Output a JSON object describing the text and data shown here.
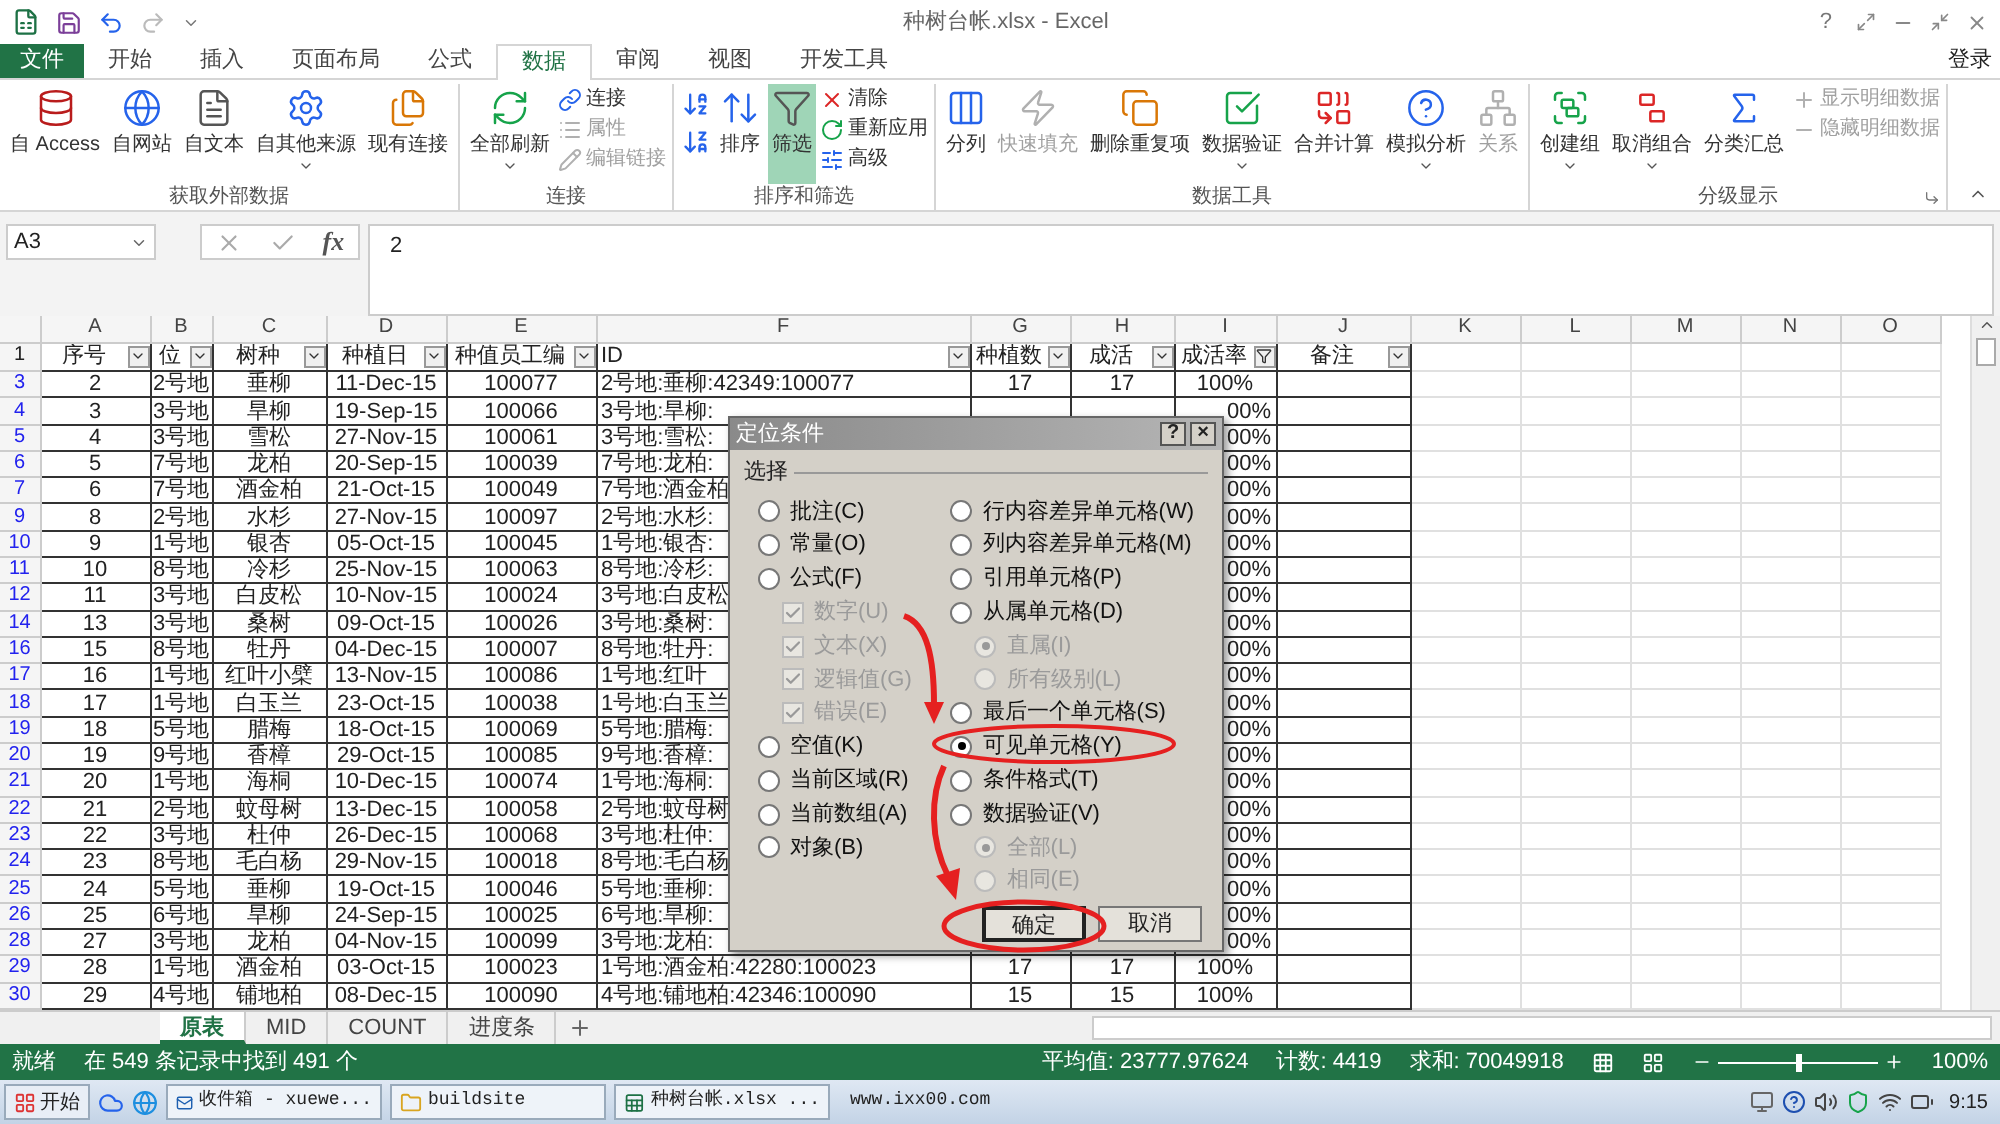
{
  "window": {
    "title": "种树台帐.xlsx - Excel",
    "help": "?"
  },
  "tabs": [
    {
      "label": "文件",
      "selected": false,
      "kind": "file"
    },
    {
      "label": "开始",
      "selected": false,
      "kind": "tab"
    },
    {
      "label": "插入",
      "selected": false,
      "kind": "tab"
    },
    {
      "label": "页面布局",
      "selected": false,
      "kind": "tab"
    },
    {
      "label": "公式",
      "selected": false,
      "kind": "tab"
    },
    {
      "label": "数据",
      "selected": true,
      "kind": "tab"
    },
    {
      "label": "审阅",
      "selected": false,
      "kind": "tab"
    },
    {
      "label": "视图",
      "selected": false,
      "kind": "tab"
    },
    {
      "label": "开发工具",
      "selected": false,
      "kind": "tab"
    }
  ],
  "account": "登录",
  "ribbon": [
    {
      "label": "获取外部数据",
      "items": [
        {
          "kind": "large",
          "label": "自 Access",
          "disabled": false
        },
        {
          "kind": "large",
          "label": "自网站",
          "disabled": false
        },
        {
          "kind": "large",
          "label": "自文本",
          "disabled": false
        },
        {
          "kind": "large",
          "label": "自其他来源",
          "disabled": false,
          "dropdown": true
        },
        {
          "kind": "large",
          "label": "现有连接",
          "disabled": false
        }
      ]
    },
    {
      "label": "连接",
      "items": [
        {
          "kind": "large",
          "label": "全部刷新",
          "disabled": false,
          "dropdown": true
        },
        {
          "kind": "small",
          "label": "连接",
          "disabled": false
        },
        {
          "kind": "small",
          "label": "属性",
          "disabled": true
        },
        {
          "kind": "small",
          "label": "编辑链接",
          "disabled": true
        }
      ]
    },
    {
      "label": "排序和筛选",
      "items": [
        {
          "kind": "sort",
          "disabled": false
        },
        {
          "kind": "sort",
          "disabled": false
        },
        {
          "kind": "large",
          "label": "排序",
          "disabled": false
        },
        {
          "kind": "large",
          "label": "筛选",
          "disabled": false,
          "on": true
        },
        {
          "kind": "small",
          "label": "清除",
          "disabled": false
        },
        {
          "kind": "small",
          "label": "重新应用",
          "disabled": false
        },
        {
          "kind": "small",
          "label": "高级",
          "disabled": false
        }
      ]
    },
    {
      "label": "数据工具",
      "items": [
        {
          "kind": "large",
          "label": "分列",
          "disabled": false
        },
        {
          "kind": "large",
          "label": "快速填充",
          "disabled": true
        },
        {
          "kind": "large",
          "label": "删除重复项",
          "disabled": false
        },
        {
          "kind": "large",
          "label": "数据验证",
          "disabled": false,
          "dropdown": true
        },
        {
          "kind": "large",
          "label": "合并计算",
          "disabled": false
        },
        {
          "kind": "large",
          "label": "模拟分析",
          "disabled": false,
          "dropdown": true
        },
        {
          "kind": "large",
          "label": "关系",
          "disabled": true
        }
      ]
    },
    {
      "label": "分级显示",
      "launcher": true,
      "items": [
        {
          "kind": "large",
          "label": "创建组",
          "disabled": false,
          "dropdown": true
        },
        {
          "kind": "large",
          "label": "取消组合",
          "disabled": false,
          "dropdown": true
        },
        {
          "kind": "large",
          "label": "分类汇总",
          "disabled": false
        },
        {
          "kind": "small",
          "label": "显示明细数据",
          "disabled": true
        },
        {
          "kind": "small",
          "label": "隐藏明细数据",
          "disabled": true
        }
      ]
    }
  ],
  "formula_bar": {
    "name_box": "A3",
    "function_label": "fx",
    "value": "2"
  },
  "sheet": {
    "columns": [
      "A",
      "B",
      "C",
      "D",
      "E",
      "F",
      "G",
      "H",
      "I",
      "J",
      "K",
      "L",
      "M",
      "N",
      "O"
    ],
    "header_row": {
      "number": "1",
      "cells": [
        {
          "text": "序号",
          "filtered": false
        },
        {
          "text": "位",
          "filtered": false
        },
        {
          "text": "树种",
          "filtered": false
        },
        {
          "text": "种植日",
          "filtered": false
        },
        {
          "text": "种值员工编",
          "filtered": false
        },
        {
          "text": "ID",
          "filtered": false
        },
        {
          "text": "种植数",
          "filtered": false
        },
        {
          "text": "成活",
          "filtered": false
        },
        {
          "text": "成活率",
          "filtered": true
        },
        {
          "text": "备注",
          "filtered": false
        }
      ]
    },
    "rows": [
      {
        "number": "3",
        "cells": [
          "2",
          "2号地",
          "垂柳",
          "11-Dec-15",
          "100077",
          "2号地:垂柳:42349:100077",
          "17",
          "17",
          "100%"
        ]
      },
      {
        "number": "4",
        "cells": [
          "3",
          "3号地",
          "旱柳",
          "19-Sep-15",
          "100066",
          "3号地:旱柳:"
        ],
        "rate": "00%"
      },
      {
        "number": "5",
        "cells": [
          "4",
          "3号地",
          "雪松",
          "27-Nov-15",
          "100061",
          "3号地:雪松:"
        ],
        "rate": "00%"
      },
      {
        "number": "6",
        "cells": [
          "5",
          "7号地",
          "龙柏",
          "20-Sep-15",
          "100039",
          "7号地:龙柏:"
        ],
        "rate": "00%"
      },
      {
        "number": "7",
        "cells": [
          "6",
          "7号地",
          "酒金柏",
          "21-Oct-15",
          "100049",
          "7号地:酒金柏"
        ],
        "rate": "00%"
      },
      {
        "number": "9",
        "cells": [
          "8",
          "2号地",
          "水杉",
          "27-Nov-15",
          "100097",
          "2号地:水杉:"
        ],
        "rate": "00%"
      },
      {
        "number": "10",
        "cells": [
          "9",
          "1号地",
          "银杏",
          "05-Oct-15",
          "100045",
          "1号地:银杏:"
        ],
        "rate": "00%"
      },
      {
        "number": "11",
        "cells": [
          "10",
          "8号地",
          "冷杉",
          "25-Nov-15",
          "100063",
          "8号地:冷杉:"
        ],
        "rate": "00%"
      },
      {
        "number": "12",
        "cells": [
          "11",
          "3号地",
          "白皮松",
          "10-Nov-15",
          "100024",
          "3号地:白皮松"
        ],
        "rate": "00%"
      },
      {
        "number": "14",
        "cells": [
          "13",
          "3号地",
          "桑树",
          "09-Oct-15",
          "100026",
          "3号地:桑树:"
        ],
        "rate": "00%"
      },
      {
        "number": "16",
        "cells": [
          "15",
          "8号地",
          "牡丹",
          "04-Dec-15",
          "100007",
          "8号地:牡丹:"
        ],
        "rate": "00%"
      },
      {
        "number": "17",
        "cells": [
          "16",
          "1号地",
          "红叶小檗",
          "13-Nov-15",
          "100086",
          "1号地:红叶"
        ],
        "rate": "00%"
      },
      {
        "number": "18",
        "cells": [
          "17",
          "1号地",
          "白玉兰",
          "23-Oct-15",
          "100038",
          "1号地:白玉兰"
        ],
        "rate": "00%"
      },
      {
        "number": "19",
        "cells": [
          "18",
          "5号地",
          "腊梅",
          "18-Oct-15",
          "100069",
          "5号地:腊梅:"
        ],
        "rate": "00%"
      },
      {
        "number": "20",
        "cells": [
          "19",
          "9号地",
          "香樟",
          "29-Oct-15",
          "100085",
          "9号地:香樟:"
        ],
        "rate": "00%"
      },
      {
        "number": "21",
        "cells": [
          "20",
          "1号地",
          "海桐",
          "10-Dec-15",
          "100074",
          "1号地:海桐:"
        ],
        "rate": "00%"
      },
      {
        "number": "22",
        "cells": [
          "21",
          "2号地",
          "蚊母树",
          "13-Dec-15",
          "100058",
          "2号地:蚊母树"
        ],
        "rate": "00%"
      },
      {
        "number": "23",
        "cells": [
          "22",
          "3号地",
          "杜仲",
          "26-Dec-15",
          "100068",
          "3号地:杜仲:"
        ],
        "rate": "00%"
      },
      {
        "number": "24",
        "cells": [
          "23",
          "8号地",
          "毛白杨",
          "29-Nov-15",
          "100018",
          "8号地:毛白杨"
        ],
        "rate": "00%"
      },
      {
        "number": "25",
        "cells": [
          "24",
          "5号地",
          "垂柳",
          "19-Oct-15",
          "100046",
          "5号地:垂柳:"
        ],
        "rate": "00%"
      },
      {
        "number": "26",
        "cells": [
          "25",
          "6号地",
          "旱柳",
          "24-Sep-15",
          "100025",
          "6号地:旱柳:"
        ],
        "rate": "00%"
      },
      {
        "number": "28",
        "cells": [
          "27",
          "3号地",
          "龙柏",
          "04-Nov-15",
          "100099",
          "3号地:龙柏:"
        ],
        "rate": "00%"
      },
      {
        "number": "29",
        "cells": [
          "28",
          "1号地",
          "酒金柏",
          "03-Oct-15",
          "100023",
          "1号地:酒金柏:42280:100023",
          "17",
          "17",
          "100%"
        ]
      },
      {
        "number": "30",
        "cells": [
          "29",
          "4号地",
          "铺地柏",
          "08-Dec-15",
          "100090",
          "4号地:铺地柏:42346:100090",
          "15",
          "15",
          "100%"
        ]
      }
    ]
  },
  "dialog": {
    "title": "定位条件",
    "help": "?",
    "close": "×",
    "group": "选择",
    "left": [
      {
        "kind": "radio",
        "label": "批注(C)",
        "selected": false,
        "disabled": false
      },
      {
        "kind": "radio",
        "label": "常量(O)",
        "selected": false,
        "disabled": false
      },
      {
        "kind": "radio",
        "label": "公式(F)",
        "selected": false,
        "disabled": false,
        "children": [
          {
            "kind": "checkbox",
            "label": "数字(U)",
            "checked": true,
            "disabled": true
          },
          {
            "kind": "checkbox",
            "label": "文本(X)",
            "checked": true,
            "disabled": true
          },
          {
            "kind": "checkbox",
            "label": "逻辑值(G)",
            "checked": true,
            "disabled": true
          },
          {
            "kind": "checkbox",
            "label": "错误(E)",
            "checked": true,
            "disabled": true
          }
        ]
      },
      {
        "kind": "radio",
        "label": "空值(K)",
        "selected": false,
        "disabled": false
      },
      {
        "kind": "radio",
        "label": "当前区域(R)",
        "selected": false,
        "disabled": false
      },
      {
        "kind": "radio",
        "label": "当前数组(A)",
        "selected": false,
        "disabled": false
      },
      {
        "kind": "radio",
        "label": "对象(B)",
        "selected": false,
        "disabled": false
      }
    ],
    "right": [
      {
        "kind": "radio",
        "label": "行内容差异单元格(W)",
        "selected": false,
        "disabled": false
      },
      {
        "kind": "radio",
        "label": "列内容差异单元格(M)",
        "selected": false,
        "disabled": false
      },
      {
        "kind": "radio",
        "label": "引用单元格(P)",
        "selected": false,
        "disabled": false
      },
      {
        "kind": "radio",
        "label": "从属单元格(D)",
        "selected": false,
        "disabled": false,
        "children": [
          {
            "kind": "radio",
            "label": "直属(I)",
            "selected": true,
            "disabled": true
          },
          {
            "kind": "radio",
            "label": "所有级别(L)",
            "selected": false,
            "disabled": true
          }
        ]
      },
      {
        "kind": "radio",
        "label": "最后一个单元格(S)",
        "selected": false,
        "disabled": false
      },
      {
        "kind": "radio",
        "label": "可见单元格(Y)",
        "selected": true,
        "disabled": false
      },
      {
        "kind": "radio",
        "label": "条件格式(T)",
        "selected": false,
        "disabled": false
      },
      {
        "kind": "radio",
        "label": "数据验证(V)",
        "selected": false,
        "disabled": false,
        "children": [
          {
            "kind": "radio",
            "label": "全部(L)",
            "selected": true,
            "disabled": true
          },
          {
            "kind": "radio",
            "label": "相同(E)",
            "selected": false,
            "disabled": true
          }
        ]
      }
    ],
    "buttons": [
      {
        "label": "确定",
        "selected": true
      },
      {
        "label": "取消",
        "selected": false
      }
    ]
  },
  "sheet_tabs": [
    {
      "label": "原表",
      "selected": true
    },
    {
      "label": "MID",
      "selected": false
    },
    {
      "label": "COUNT",
      "selected": false
    },
    {
      "label": "进度条",
      "selected": false
    }
  ],
  "status_bar": {
    "mode": "就绪",
    "message": "在 549 条记录中找到 491 个",
    "average": "平均值: 23777.97624",
    "count": "计数: 4419",
    "sum": "求和: 70049918",
    "zoom": {
      "reading": "100%",
      "level": 0.5
    }
  },
  "taskbar": {
    "start": "开始",
    "windows": [
      {
        "label": "收件箱 - xuewe...",
        "kind": "mail"
      },
      {
        "label": "buildsite",
        "kind": "folder"
      },
      {
        "label": "种树台帐.xlsx ...",
        "kind": "excel"
      },
      {
        "label": "www.ixx00.com",
        "kind": "text"
      }
    ],
    "clock": "9:15"
  }
}
